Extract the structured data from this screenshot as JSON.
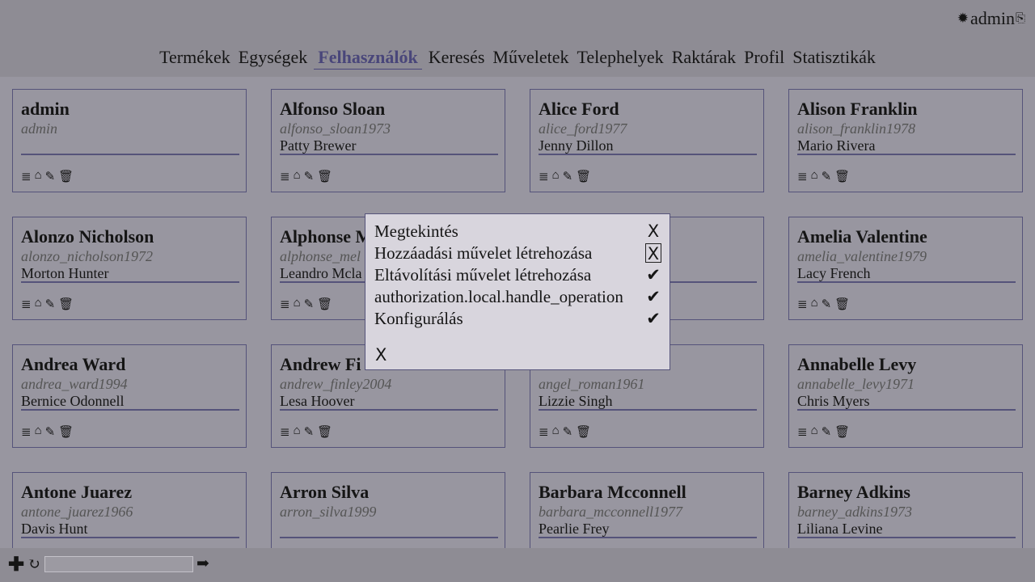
{
  "header": {
    "user_icon": "✹",
    "username": "admin",
    "logout_icon": "⎘"
  },
  "nav": [
    "Termékek",
    "Egységek",
    "Felhasználók",
    "Keresés",
    "Műveletek",
    "Telephelyek",
    "Raktárak",
    "Profil",
    "Statisztikák"
  ],
  "nav_active": "Felhasználók",
  "icons": {
    "list": "≣",
    "warehouse": "⌂",
    "edit": "✎",
    "delete": "🗑"
  },
  "users": [
    {
      "name": "admin",
      "username": "admin",
      "contact": ""
    },
    {
      "name": "Alfonso Sloan",
      "username": "alfonso_sloan1973",
      "contact": "Patty Brewer"
    },
    {
      "name": "Alice Ford",
      "username": "alice_ford1977",
      "contact": "Jenny Dillon"
    },
    {
      "name": "Alison Franklin",
      "username": "alison_franklin1978",
      "contact": "Mario Rivera"
    },
    {
      "name": "Alonzo Nicholson",
      "username": "alonzo_nicholson1972",
      "contact": "Morton Hunter"
    },
    {
      "name": "Alphonse M",
      "username": "alphonse_mel",
      "contact": "Leandro Mcla"
    },
    {
      "name": "",
      "username": "",
      "contact": ""
    },
    {
      "name": "Amelia Valentine",
      "username": "amelia_valentine1979",
      "contact": "Lacy French"
    },
    {
      "name": "Andrea Ward",
      "username": "andrea_ward1994",
      "contact": "Bernice Odonnell"
    },
    {
      "name": "Andrew Fi",
      "username": "andrew_finley2004",
      "contact": "Lesa Hoover"
    },
    {
      "name": "",
      "username": "angel_roman1961",
      "contact": "Lizzie Singh"
    },
    {
      "name": "Annabelle Levy",
      "username": "annabelle_levy1971",
      "contact": "Chris Myers"
    },
    {
      "name": "Antone Juarez",
      "username": "antone_juarez1966",
      "contact": "Davis Hunt"
    },
    {
      "name": "Arron Silva",
      "username": "arron_silva1999",
      "contact": ""
    },
    {
      "name": "Barbara Mcconnell",
      "username": "barbara_mcconnell1977",
      "contact": "Pearlie Frey"
    },
    {
      "name": "Barney Adkins",
      "username": "barney_adkins1973",
      "contact": "Liliana Levine"
    }
  ],
  "modal": {
    "permissions": [
      {
        "label": "Megtekintés",
        "mark": "X",
        "focused": false
      },
      {
        "label": "Hozzáadási művelet létrehozása",
        "mark": "X",
        "focused": true
      },
      {
        "label": "Eltávolítási művelet létrehozása",
        "mark": "✔",
        "focused": false
      },
      {
        "label": "authorization.local.handle_operation",
        "mark": "✔",
        "focused": false
      },
      {
        "label": "Konfigurálás",
        "mark": "✔",
        "focused": false
      }
    ],
    "close_label": "X"
  },
  "bottom": {
    "add_icon": "✚",
    "refresh_icon": "↻",
    "search_value": "",
    "go_icon": "➡"
  }
}
